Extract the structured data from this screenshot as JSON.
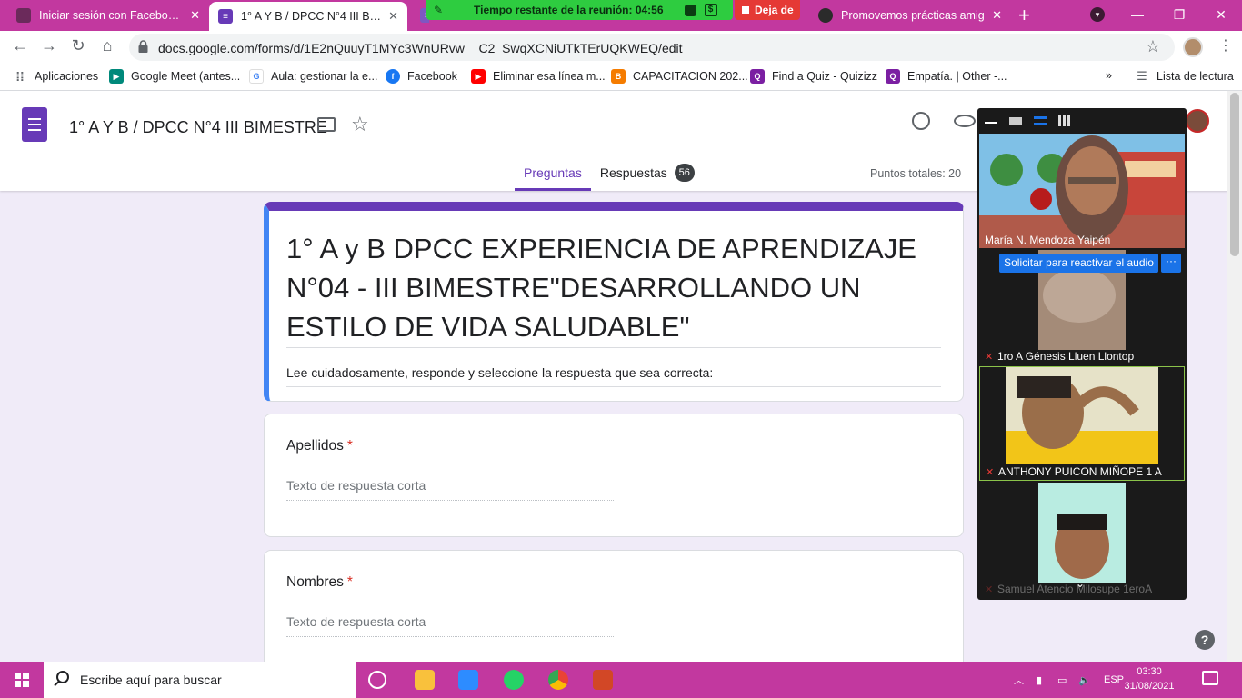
{
  "browser": {
    "tabs": [
      {
        "title": "Iniciar sesión con Facebook -",
        "active": false
      },
      {
        "title": "1° A Y B / DPCC N°4 III BIMES",
        "active": true
      },
      {
        "title": "",
        "active": false
      },
      {
        "title": "Promovemos prácticas amig",
        "active": false
      }
    ],
    "url": "docs.google.com/forms/d/1E2nQuuyT1MYc3WnURvw__C2_SwqXCNiUTkTErUQKWEQ/edit",
    "bookmarks": [
      {
        "label": "Aplicaciones",
        "icon": "apps-grid-icon",
        "color": "#5f6368"
      },
      {
        "label": "Google Meet (antes...",
        "icon": "meet-icon",
        "color": "#00897b"
      },
      {
        "label": "Aula: gestionar la e...",
        "icon": "google-icon",
        "color": "#4285f4"
      },
      {
        "label": "Facebook",
        "icon": "facebook-icon",
        "color": "#1877f2"
      },
      {
        "label": "Eliminar esa línea m...",
        "icon": "youtube-icon",
        "color": "#ff0000"
      },
      {
        "label": "CAPACITACION 202...",
        "icon": "blogger-icon",
        "color": "#f57c00"
      },
      {
        "label": "Find a Quiz - Quizizz",
        "icon": "quizizz-icon",
        "color": "#7b1fa2"
      },
      {
        "label": "Empatía. | Other -...",
        "icon": "quizizz-icon",
        "color": "#7b1fa2"
      }
    ],
    "reading_list": "Lista de lectura"
  },
  "meet": {
    "timer": "Tiempo restante de la reunión: 04:56",
    "leave": "Deja de",
    "participants": [
      {
        "name": "María N. Mendoza Yaipén",
        "muted": false
      },
      {
        "name": "1ro A Génesis Lluen Llontop",
        "muted": true
      },
      {
        "name": "ANTHONY PUICON MIÑOPE 1 A",
        "muted": true
      },
      {
        "name": "Samuel Atencio Milosupe 1eroA",
        "muted": true
      }
    ],
    "unmute_request": "Solicitar para reactivar el audio",
    "more": "···"
  },
  "form": {
    "doc_title": "1° A Y B / DPCC N°4 III BIMESTRE",
    "tab_questions": "Preguntas",
    "tab_responses": "Respuestas",
    "responses_count": "56",
    "total_points": "Puntos totales: 20",
    "title": "1°  A y B DPCC EXPERIENCIA DE APRENDIZAJE N°04 - III BIMESTRE\"DESARROLLANDO UN ESTILO DE VIDA SALUDABLE\"",
    "description": "Lee cuidadosamente, responde y seleccione la respuesta que sea correcta:",
    "questions": [
      {
        "label": "Apellidos",
        "required": "*",
        "placeholder": "Texto de respuesta corta"
      },
      {
        "label": "Nombres",
        "required": "*",
        "placeholder": "Texto de respuesta corta"
      }
    ]
  },
  "taskbar": {
    "search_placeholder": "Escribe aquí para buscar",
    "language": "ESP",
    "time": "03:30",
    "date": "31/08/2021"
  },
  "colors": {
    "accent": "#673ab7",
    "chrome_frame": "#c2389f",
    "meet_timer": "#2ecc40",
    "meet_leave": "#e53935",
    "link_blue": "#1a73e8"
  }
}
